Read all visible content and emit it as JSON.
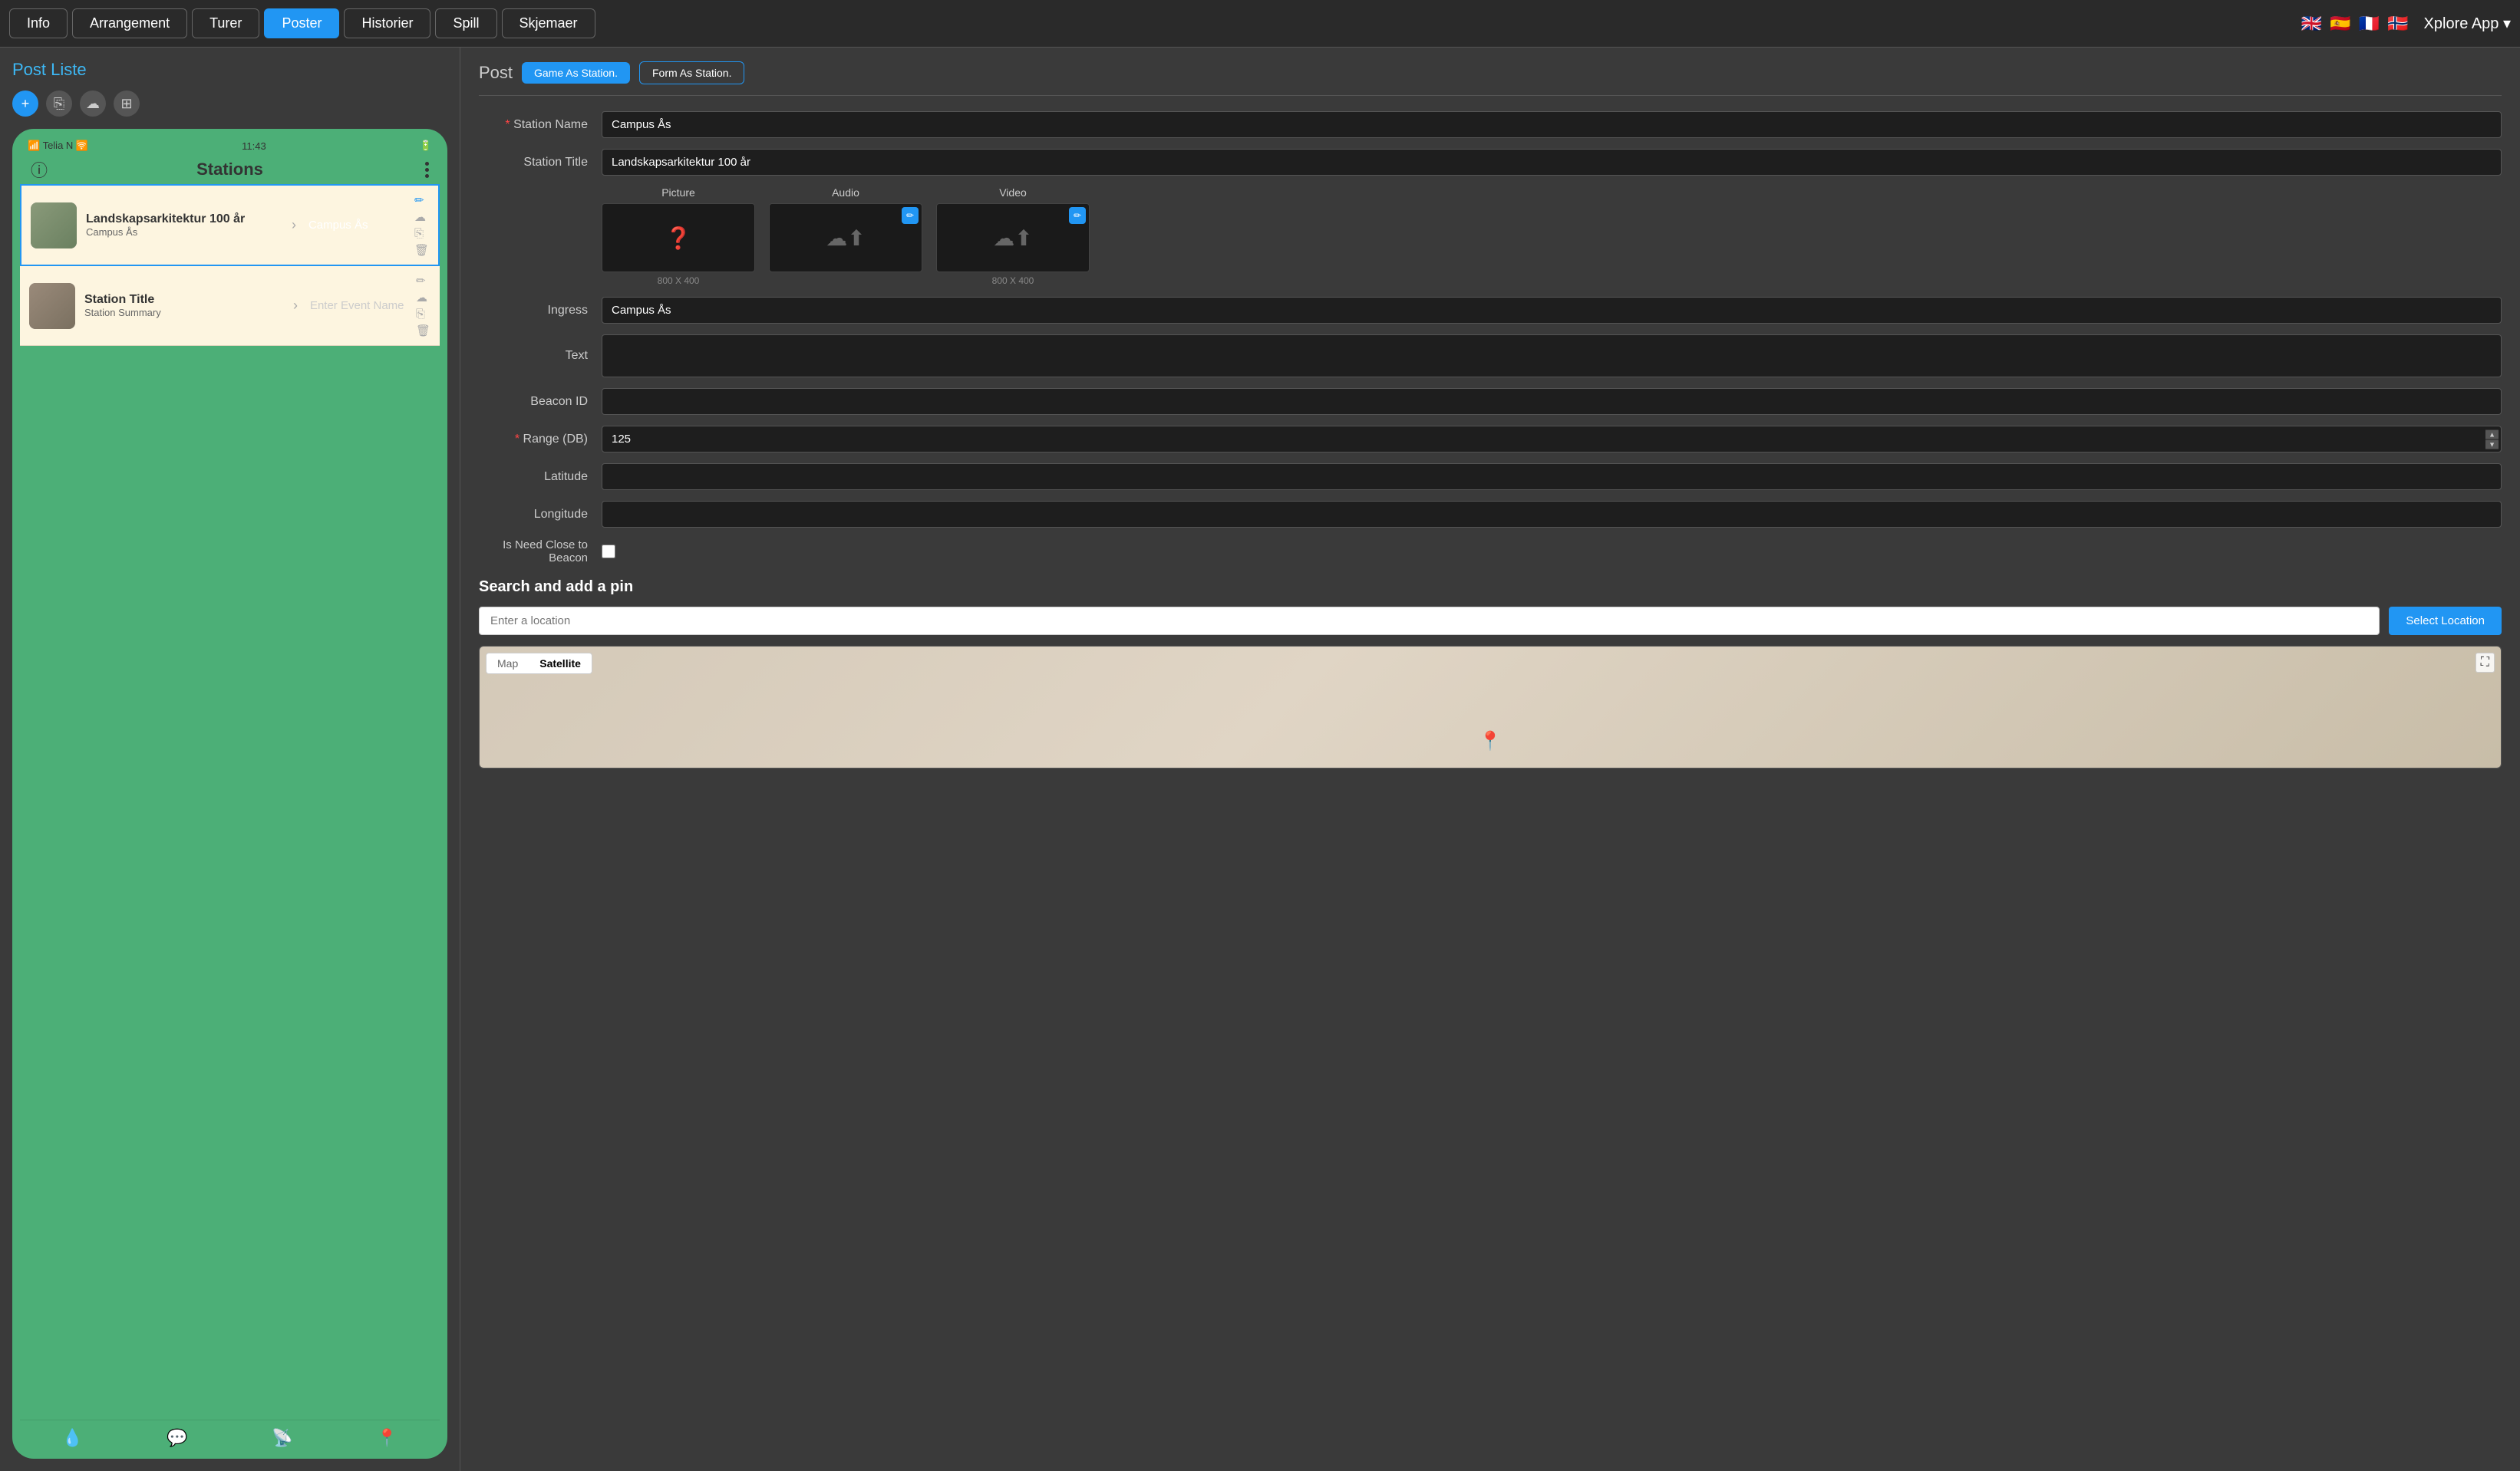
{
  "nav": {
    "tabs": [
      {
        "label": "Info",
        "active": false
      },
      {
        "label": "Arrangement",
        "active": false
      },
      {
        "label": "Turer",
        "active": false
      },
      {
        "label": "Poster",
        "active": true
      },
      {
        "label": "Historier",
        "active": false
      },
      {
        "label": "Spill",
        "active": false
      },
      {
        "label": "Skjemaer",
        "active": false
      }
    ],
    "app_name": "Xplore App ▾",
    "flags": [
      "🇬🇧",
      "🇪🇸",
      "🇫🇷",
      "🇳🇴"
    ]
  },
  "left_panel": {
    "title": "Post Liste",
    "toolbar": {
      "add": "+",
      "copy": "⎘",
      "cloud": "☁",
      "layers": "⊞"
    },
    "phone": {
      "carrier": "Telia N",
      "time": "11:43",
      "header_title": "Stations",
      "stations": [
        {
          "name": "Landskapsarkitektur 100 år",
          "sub": "Campus Ås",
          "event_name": "Campus Ås",
          "selected": true
        },
        {
          "name": "Station Title",
          "sub": "Station Summary",
          "event_name": "Enter Event Name",
          "selected": false
        }
      ]
    }
  },
  "right_panel": {
    "post_label": "Post",
    "btn_game": "Game As Station.",
    "btn_form": "Form As Station.",
    "fields": {
      "station_name_label": "Station Name",
      "station_name_value": "Campus Ås",
      "station_title_label": "Station Title",
      "station_title_value": "Landskapsarkitektur 100 år",
      "ingress_label": "Ingress",
      "ingress_value": "Campus Ås",
      "text_label": "Text",
      "text_value": "",
      "beacon_id_label": "Beacon ID",
      "beacon_id_value": "",
      "range_db_label": "Range (DB)",
      "range_db_value": "125",
      "latitude_label": "Latitude",
      "latitude_value": "",
      "longitude_label": "Longitude",
      "longitude_value": "",
      "need_beacon_label": "Is Need Close to Beacon"
    },
    "media": {
      "picture_label": "Picture",
      "audio_label": "Audio",
      "video_label": "Video",
      "size_label": "800 X 400"
    },
    "map": {
      "section_title": "Search and add a pin",
      "search_placeholder": "Enter a location",
      "select_btn": "Select Location",
      "map_tab": "Map",
      "satellite_tab": "Satellite"
    }
  }
}
